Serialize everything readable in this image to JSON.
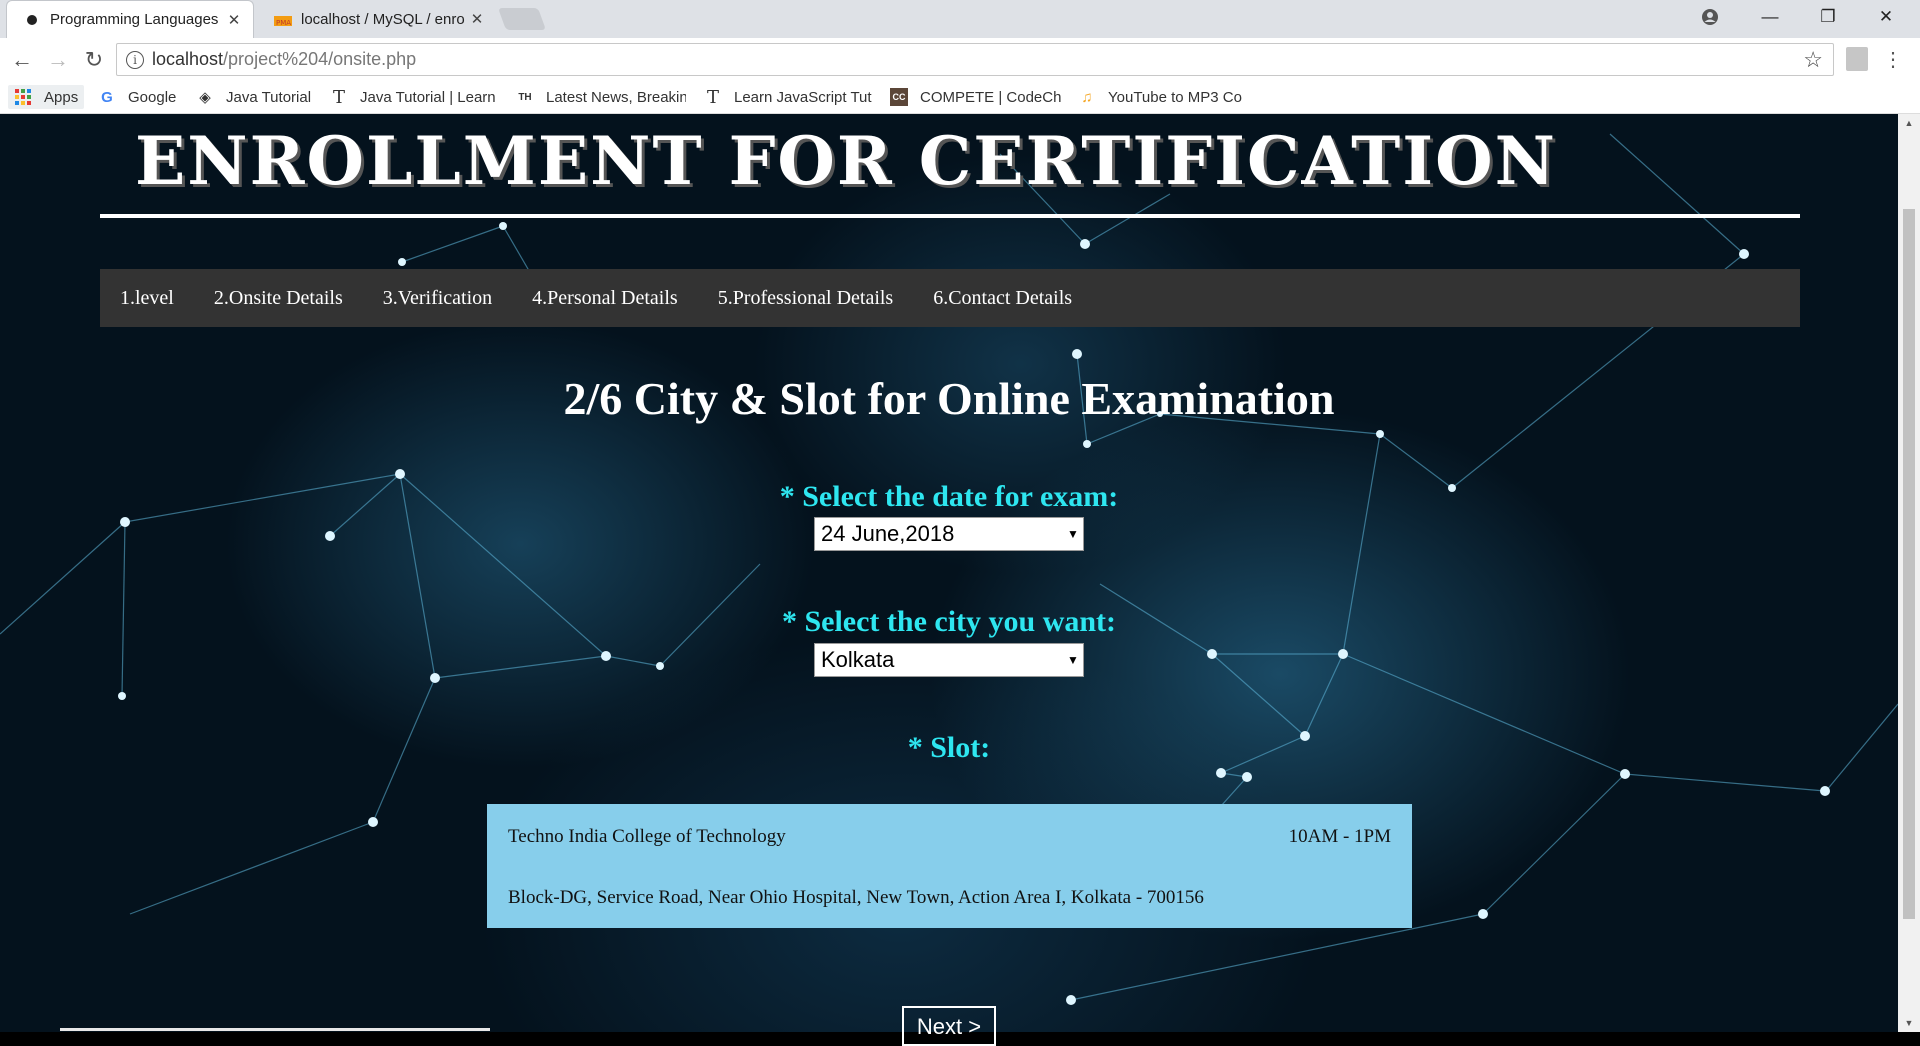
{
  "browser": {
    "tabs": [
      {
        "title": "Programming Languages",
        "active": true
      },
      {
        "title": "localhost / MySQL / enro",
        "active": false
      }
    ],
    "address": {
      "host": "localhost",
      "path": "/project%204/onsite.php"
    },
    "bookmarks": [
      {
        "label": "Apps",
        "icon": "apps-grid-icon"
      },
      {
        "label": "Google",
        "icon": "google-icon"
      },
      {
        "label": "Java Tutorial",
        "icon": "java-tutorial-icon"
      },
      {
        "label": "Java Tutorial | Learn",
        "icon": "t-icon"
      },
      {
        "label": "Latest News, Breakin",
        "icon": "th-icon"
      },
      {
        "label": "Learn JavaScript Tut",
        "icon": "t-icon"
      },
      {
        "label": "COMPETE | CodeChe",
        "icon": "codechef-icon"
      },
      {
        "label": "YouTube to MP3 Co",
        "icon": "mp3-icon"
      }
    ]
  },
  "page": {
    "header_title": "ENROLLMENT FOR CERTIFICATION",
    "steps": [
      "1.level",
      "2.Onsite Details",
      "3.Verification",
      "4.Personal Details",
      "5.Professional Details",
      "6.Contact Details"
    ],
    "section_title": "2/6 City & Slot for Online Examination",
    "date_label": "* Select the date for exam:",
    "date_value": "24 June,2018",
    "city_label": "* Select the city you want:",
    "city_value": "Kolkata",
    "slot_label": "* Slot:",
    "slot": {
      "venue": "Techno India College of Technology",
      "time": "10AM - 1PM",
      "address": "Block-DG, Service Road, Near Ohio Hospital, New Town, Action Area I, Kolkata - 700156"
    },
    "next_label": "Next >"
  },
  "colors": {
    "accent_label": "#2ee6f0",
    "slot_card": "#87ceeb",
    "steps_bar": "#333333"
  }
}
